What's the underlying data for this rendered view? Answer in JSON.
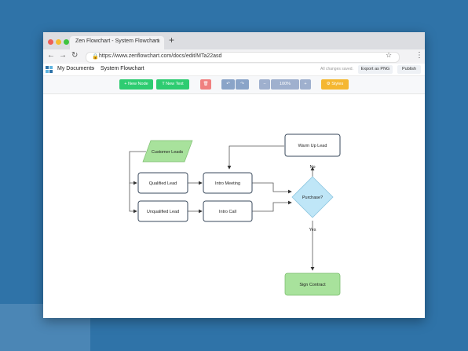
{
  "browser": {
    "tab_title": "Zen Flowchart - System Flowchart",
    "tab_close": "×",
    "new_tab": "+",
    "url": "https://www.zenflowchart.com/docs/edit/MTa22asd",
    "back_icon": "arrow-left-icon",
    "forward_icon": "arrow-right-icon",
    "reload_icon": "reload-icon",
    "back_glyph": "←",
    "forward_glyph": "→",
    "reload_glyph": "↻",
    "lock_glyph": "🔒",
    "star_glyph": "☆",
    "menu_glyph": "⋮"
  },
  "header": {
    "my_documents": "My Documents",
    "separator": "›",
    "doc_title": "System Flowchart",
    "saved_status": "All changes saved.",
    "export_label": "Export as PNG",
    "publish_label": "Publish"
  },
  "toolbar": {
    "new_node": "+ New Node",
    "new_text": "T New Text",
    "delete_glyph": "🗑",
    "undo_glyph": "↶",
    "redo_glyph": "↷",
    "zoom_out": "−",
    "zoom_level": "100%",
    "zoom_in": "+",
    "styles": "⚙ Styles"
  },
  "flowchart": {
    "customer_leads": "Customer Leads",
    "qualified_lead": "Qualified Lead",
    "unqualified_lead": "Unqualified Lead",
    "intro_meeting": "Intro Meeting",
    "intro_call": "Intro Call",
    "purchase": "Purchase?",
    "warm_up_lead": "Warm Up Lead",
    "sign_contract": "Sign Contract",
    "no_label": "No",
    "yes_label": "Yes"
  },
  "colors": {
    "background": "#2f73a8",
    "green_button": "#2ecc71",
    "delete_button": "#f08080",
    "undo_redo": "#8aa4c8",
    "zoom": "#9fb0ce",
    "styles_button": "#f5b731",
    "node_green": "#a8e29c",
    "decision_blue": "#bfe6f7",
    "node_border": "#3a4a5c"
  }
}
